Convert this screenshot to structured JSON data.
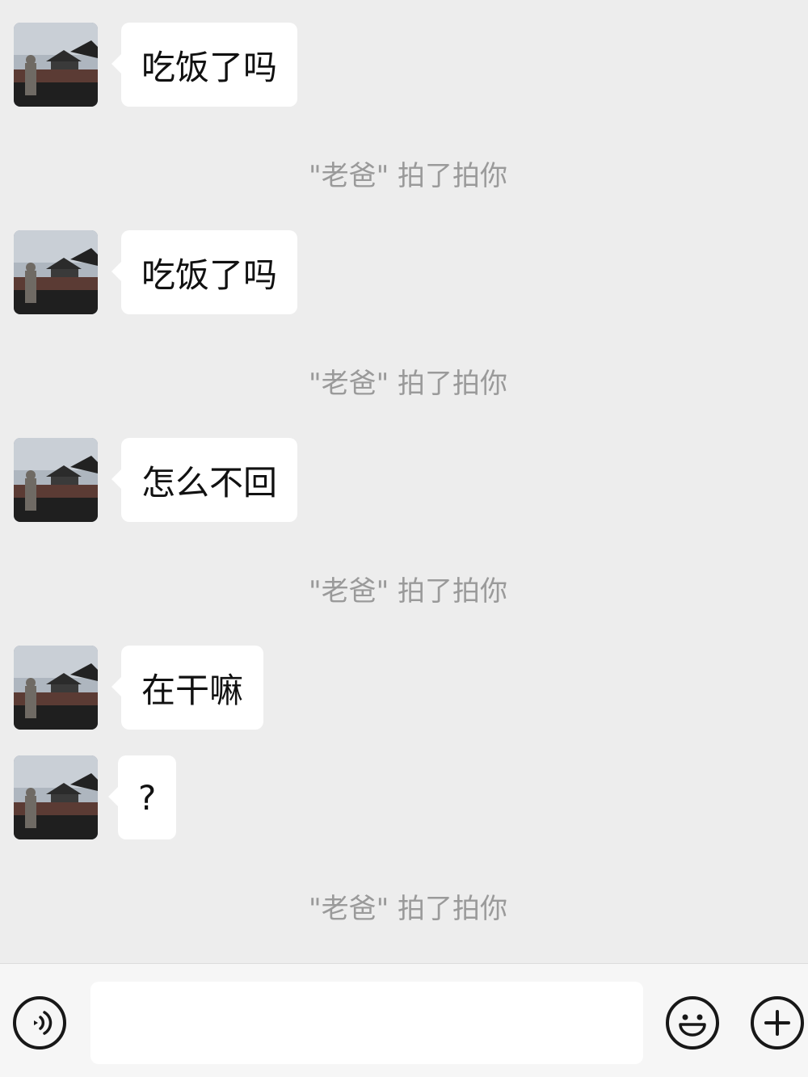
{
  "messages": [
    {
      "sender": "老爸",
      "text": "吃饭了吗"
    },
    {
      "sender": "老爸",
      "text": "吃饭了吗"
    },
    {
      "sender": "老爸",
      "text": "怎么不回"
    },
    {
      "sender": "老爸",
      "text": "在干嘛"
    },
    {
      "sender": "老爸",
      "text": "?"
    }
  ],
  "system_notices": [
    "\"老爸\" 拍了拍你",
    "\"老爸\" 拍了拍你",
    "\"老爸\" 拍了拍你",
    "\"老爸\" 拍了拍你"
  ],
  "input_bar": {
    "voice_icon": "voice-icon",
    "emoji_icon": "smiley-icon",
    "plus_icon": "plus-icon",
    "input_value": ""
  },
  "colors": {
    "background": "#ededed",
    "bubble": "#ffffff",
    "system_text": "#9a9a9a",
    "icon_stroke": "#181818"
  }
}
